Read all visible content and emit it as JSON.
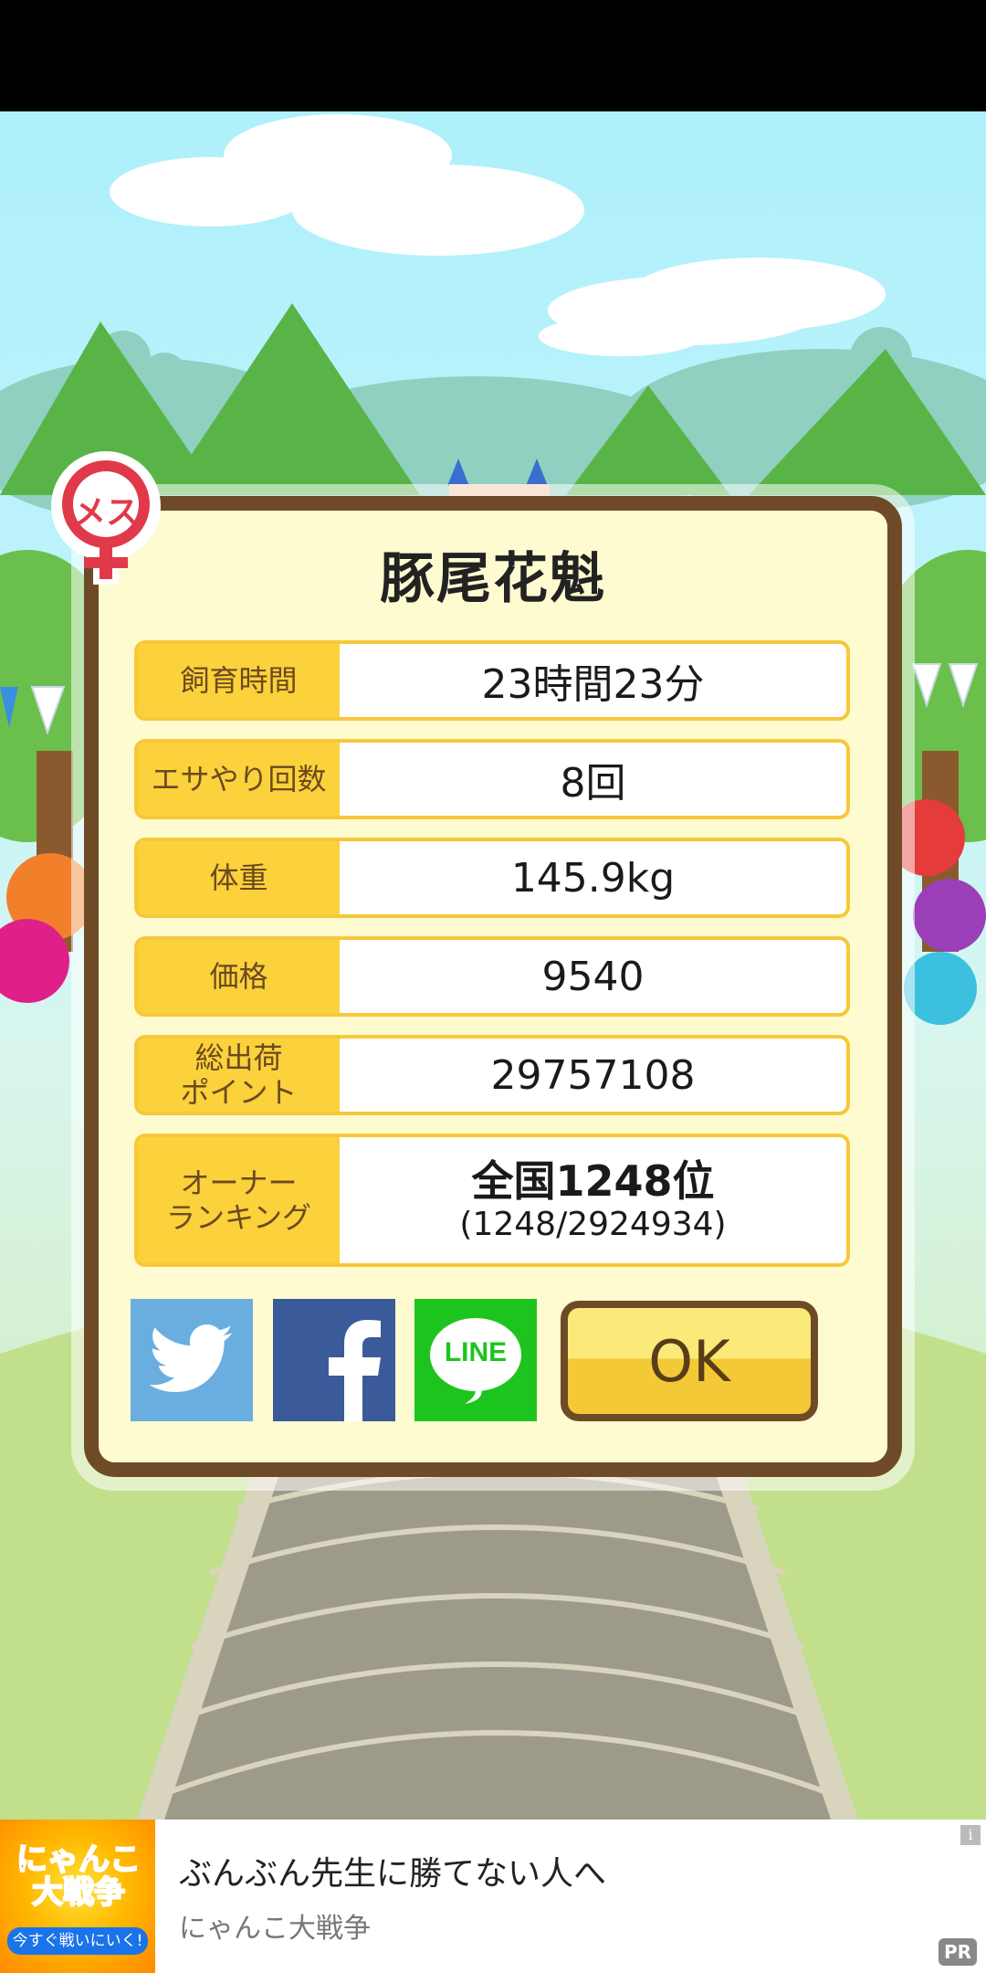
{
  "gender_badge": {
    "text": "メス",
    "color": "#e03a4a",
    "icon": "female-symbol-icon"
  },
  "dialog": {
    "title": "豚尾花魁",
    "rows": [
      {
        "label": "飼育時間",
        "value": "23時間23分"
      },
      {
        "label": "エサやり回数",
        "value": "8回"
      },
      {
        "label": "体重",
        "value": "145.9kg"
      },
      {
        "label": "価格",
        "value": "9540"
      },
      {
        "label": "総出荷\nポイント",
        "value": "29757108"
      },
      {
        "label": "オーナー\nランキング",
        "value": "全国1248位",
        "value_sub": "(1248/2924934)"
      }
    ],
    "share": {
      "twitter_icon": "twitter-bird-icon",
      "facebook_icon": "facebook-f-icon",
      "line_label": "LINE"
    },
    "ok_label": "OK"
  },
  "ad": {
    "thumb_title": "にゃんこ大戦争",
    "thumb_button": "今すぐ戦いにいく!",
    "title": "ぶんぶん先生に勝てない人へ",
    "subtitle": "にゃんこ大戦争",
    "info_icon": "i",
    "pr_label": "PR"
  },
  "colors": {
    "frame_brown": "#6e4b26",
    "label_yellow": "#fbd13c",
    "dialog_bg": "#fffbd0",
    "twitter": "#6aaee0",
    "facebook": "#3b5a9a",
    "line": "#1ec41e"
  }
}
